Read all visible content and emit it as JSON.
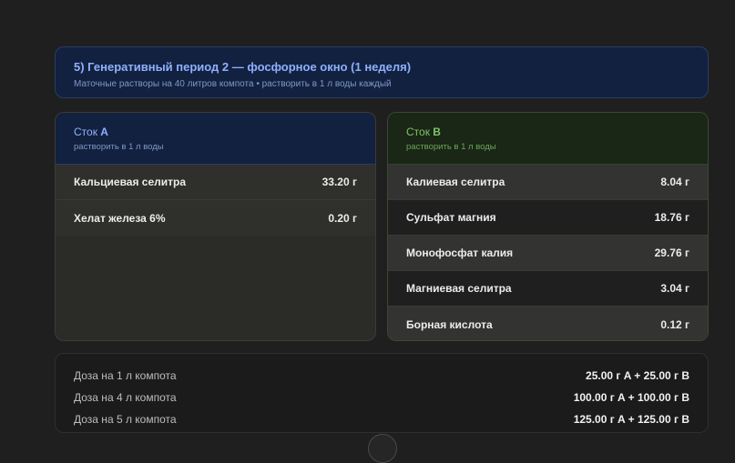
{
  "header": {
    "title": "5) Генеративный период 2 — фосфорное окно (1 неделя)",
    "subtitle": "Маточные растворы на 40 литров компота • растворить в 1 л воды каждый"
  },
  "stock_a": {
    "title_prefix": "Сток ",
    "title_letter": "A",
    "subtitle": "растворить в 1 л воды",
    "rows": [
      {
        "name": "Кальциевая селитра",
        "value": "33.20 г"
      },
      {
        "name": "Хелат железа 6%",
        "value": "0.20 г"
      }
    ]
  },
  "stock_b": {
    "title_prefix": "Сток ",
    "title_letter": "B",
    "subtitle": "растворить в 1 л воды",
    "rows": [
      {
        "name": "Калиевая селитра",
        "value": "8.04 г"
      },
      {
        "name": "Сульфат магния",
        "value": "18.76 г"
      },
      {
        "name": "Монофосфат калия",
        "value": "29.76 г"
      },
      {
        "name": "Магниевая селитра",
        "value": "3.04 г"
      },
      {
        "name": "Борная кислота",
        "value": "0.12 г"
      }
    ]
  },
  "doses": [
    {
      "label": "Доза на 1 л компота",
      "value": "25.00 г A + 25.00 г B"
    },
    {
      "label": "Доза на 4 л компота",
      "value": "100.00 г A + 100.00 г B"
    },
    {
      "label": "Доза на 5 л компота",
      "value": "125.00 г A + 125.00 г B"
    }
  ],
  "colors": {
    "background": "#1f1f1f",
    "accent_blue": "#8fb0ff",
    "accent_green": "#7fc26a"
  }
}
